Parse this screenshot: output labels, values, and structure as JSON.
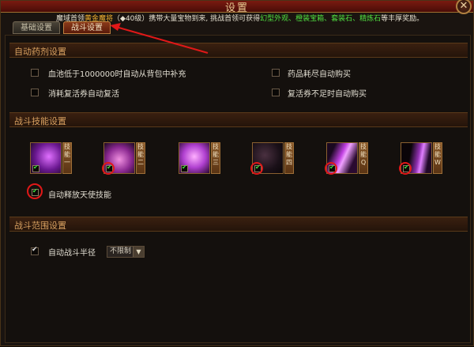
{
  "window": {
    "title": "设置",
    "close_glyph": "✕"
  },
  "notice": {
    "pre": "魔域首领",
    "boss": "黄金魔将",
    "level": "（◆40级）",
    "mid": "携带大量宝物到来, 挑战首领可获得",
    "rewards": "幻型外观、橙装宝箱、套装石、精炼石",
    "post": "等丰厚奖励。"
  },
  "tabs": [
    {
      "label": "基础设置",
      "active": false
    },
    {
      "label": "战斗设置",
      "active": true
    }
  ],
  "auto_potion": {
    "title": "自动药剂设置",
    "options": [
      {
        "label": "血池低于1000000时自动从背包中补充",
        "checked": false
      },
      {
        "label": "药品耗尽自动购买",
        "checked": false
      },
      {
        "label": "消耗复活券自动复活",
        "checked": false
      },
      {
        "label": "复活券不足时自动购买",
        "checked": false
      }
    ]
  },
  "battle_skills": {
    "title": "战斗技能设置",
    "skills": [
      {
        "key": "技能一",
        "checked": true,
        "highlighted": false,
        "color": "#c040e0"
      },
      {
        "key": "技能二",
        "checked": true,
        "highlighted": true,
        "color": "#d050c0"
      },
      {
        "key": "技能三",
        "checked": true,
        "highlighted": false,
        "color": "#e060f0"
      },
      {
        "key": "技能四",
        "checked": true,
        "highlighted": true,
        "color": "#402838"
      },
      {
        "key": "技能Q",
        "checked": true,
        "highlighted": true,
        "color": "#a030c0"
      },
      {
        "key": "技能W",
        "checked": true,
        "highlighted": true,
        "color": "#8020a0"
      }
    ],
    "angel_label": "自动释放天使技能",
    "angel_checked": true
  },
  "battle_range": {
    "title": "战斗范围设置",
    "radius_label": "自动战斗半径",
    "radius_checked": true,
    "radius_value": "不限制"
  },
  "colors": {
    "accent": "#d8a060",
    "annotation": "#e01818",
    "gold": "#f0b030",
    "green": "#50e040"
  }
}
